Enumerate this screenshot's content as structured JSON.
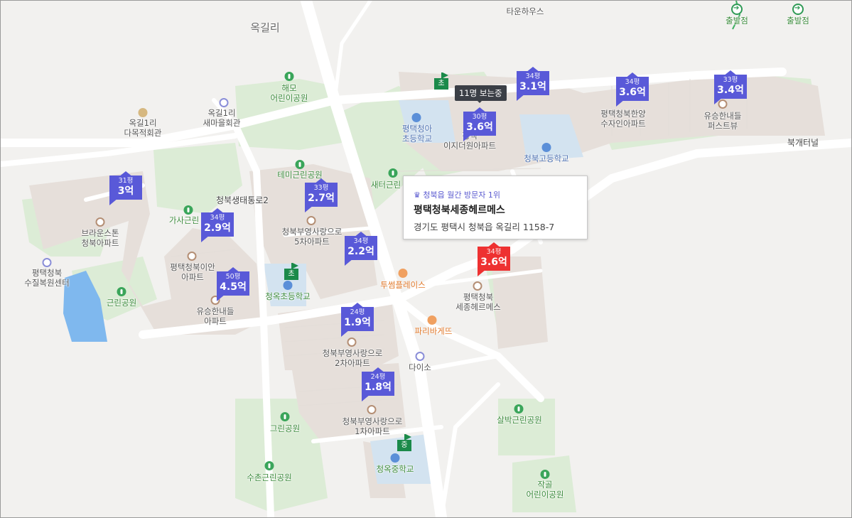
{
  "tooltip": "11명 보는중",
  "card": {
    "rank_text": "청북읍 월간 방문자 1위",
    "name": "평택청북세종헤르메스",
    "address": "경기도 평택시 청북읍 옥길리 1158-7"
  },
  "price_pins": [
    {
      "size": "31평",
      "price": "3억",
      "color": "blue"
    },
    {
      "size": "34평",
      "price": "2.9억",
      "color": "blue"
    },
    {
      "size": "33평",
      "price": "2.7억",
      "color": "blue"
    },
    {
      "size": "34평",
      "price": "2.2억",
      "color": "blue"
    },
    {
      "size": "50평",
      "price": "4.5억",
      "color": "blue"
    },
    {
      "size": "24평",
      "price": "1.9억",
      "color": "blue"
    },
    {
      "size": "24평",
      "price": "1.8억",
      "color": "blue"
    },
    {
      "size": "30평",
      "price": "3.6억",
      "color": "blue"
    },
    {
      "size": "34평",
      "price": "3.1억",
      "color": "blue"
    },
    {
      "size": "34평",
      "price": "3.6억",
      "color": "blue"
    },
    {
      "size": "33평",
      "price": "3.4억",
      "color": "blue"
    },
    {
      "size": "34평",
      "price": "3.6억",
      "color": "red"
    }
  ],
  "school_flags": [
    "초",
    "초",
    "중"
  ],
  "start_points": [
    "출발점",
    "출발점"
  ],
  "labels": {
    "okgilri": "옥길리",
    "townhouse_a": "타운하우스",
    "haemo": "해모",
    "kids_park_1": "어린이공원",
    "okgil1_hall_a": "옥길1리",
    "okgil1_hall_b": "새마을회관",
    "multi_hall_a": "옥길1리",
    "multi_hall_b": "다목적회관",
    "temi_park": "테미근린공원",
    "saeteo_park": "새터근린",
    "chungbuk_eco_road": "청북생태통로2",
    "gasa_park": "가사근린",
    "brown_a": "브라운스톤",
    "brown_b": "청북아파트",
    "iann_a": "평택청북이안",
    "iann_b": "아파트",
    "water_a": "평택청북",
    "water_b": "수질복원센터",
    "geunrin_park": "근린공원",
    "yuseung_a": "유승한내들",
    "yuseung_b": "아파트",
    "cheongok_elem": "청옥초등학교",
    "buyoung5_a": "청북부영사랑으로",
    "buyoung5_b": "5차아파트",
    "buyoung2_a": "청북부영사랑으로",
    "buyoung2_b": "2차아파트",
    "buyoung1_a": "청북부영사랑으로",
    "buyoung1_b": "1차아파트",
    "green_park": "그린공원",
    "suchon_park": "수촌근린공원",
    "cheongok_mid": "청옥중학교",
    "twosome": "투썸플레이스",
    "paris": "파리바게뜨",
    "daiso": "다이소",
    "hermes_a": "평택청북",
    "hermes_b": "세종헤르메스",
    "salbak_park": "살박근린공원",
    "jakgol_a": "작골",
    "jakgol_b": "어린이공원",
    "cheonga_a": "평택청아",
    "cheonga_b": "초등학교",
    "easy_a": "평택",
    "easy_b": "이지더원아파트",
    "cb_high": "청북고등학교",
    "hanyang_a": "평택청북한양",
    "hanyang_b": "수자인아파트",
    "firstview_a": "유승한내들",
    "firstview_b": "퍼스트뷰",
    "bukgae": "북개터널"
  }
}
